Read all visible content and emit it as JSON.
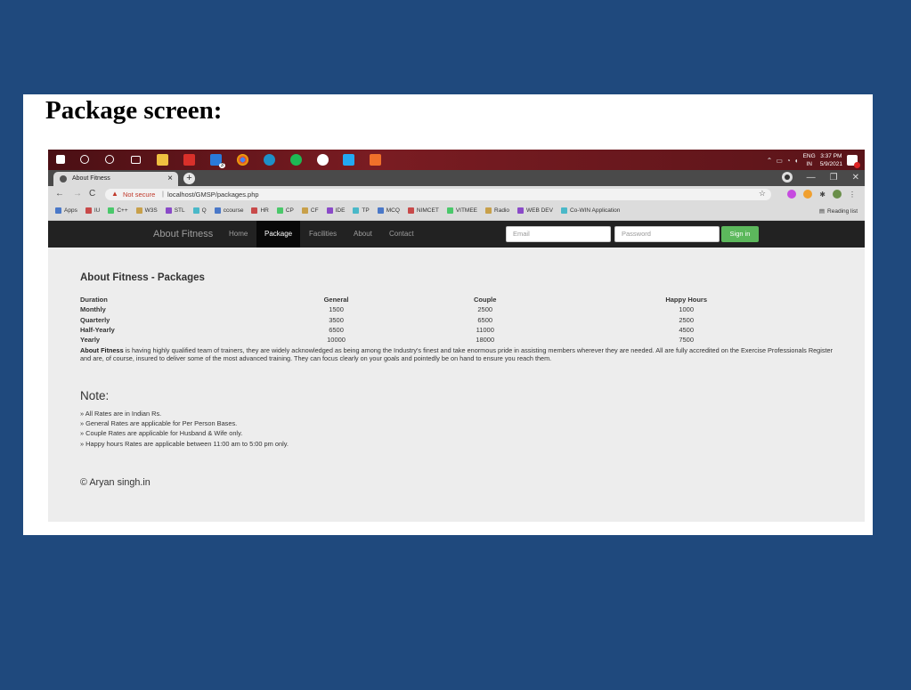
{
  "slide": {
    "heading": "Package screen:"
  },
  "taskbar": {
    "lang_line1": "ENG",
    "lang_line2": "IN",
    "time": "3:37 PM",
    "date": "5/9/2021",
    "mail_badge": "3",
    "notif_badge": "1"
  },
  "browser": {
    "tab_title": "About Fitness",
    "security_label": "Not secure",
    "url": "localhost/GMSP/packages.php",
    "bookmarks": [
      "Apps",
      "IU",
      "C++",
      "W3S",
      "STL",
      "Q",
      "ccourse",
      "HR",
      "CP",
      "CF",
      "IDE",
      "TP",
      "MCQ",
      "NIMCET",
      "VITMEE",
      "Radio",
      "WEB DEV",
      "Co-WIN Application"
    ],
    "reading_list": "Reading list"
  },
  "navbar": {
    "brand": "About Fitness",
    "items": [
      "Home",
      "Package",
      "Facilities",
      "About",
      "Contact"
    ],
    "active": "Package",
    "email_placeholder": "Email",
    "password_placeholder": "Password",
    "signin_label": "Sign in"
  },
  "page": {
    "title": "About Fitness - Packages",
    "table": {
      "headers": [
        "Duration",
        "General",
        "Couple",
        "Happy Hours"
      ],
      "rows": [
        [
          "Monthly",
          "1500",
          "2500",
          "1000"
        ],
        [
          "Quarterly",
          "3500",
          "6500",
          "2500"
        ],
        [
          "Half-Yearly",
          "6500",
          "11000",
          "4500"
        ],
        [
          "Yearly",
          "10000",
          "18000",
          "7500"
        ]
      ]
    },
    "about_bold": "About Fitness",
    "about_text": " is having highly qualified team of trainers, they are widely acknowledged as being among the Industry's finest and take enormous pride in assisting members wherever they are needed. All are fully accredited on the Exercise Professionals Register and are, of course, insured to deliver some of the most advanced training. They can focus clearly on your goals and pointedly be on hand to ensure you reach them.",
    "note_title": "Note:",
    "notes": [
      "» All Rates are in Indian Rs.",
      "» General Rates are applicable for Per Person Bases.",
      "» Couple Rates are applicable for Husband & Wife only.",
      "» Happy hours Rates are applicable between 11:00 am to 5:00 pm only."
    ],
    "copyright": "© Aryan singh.in"
  },
  "colors": {
    "slide_bg": "#1f497d",
    "navbar_bg": "#222222",
    "signin_green": "#5cb85c",
    "taskbar_red": "#7a1c22"
  }
}
